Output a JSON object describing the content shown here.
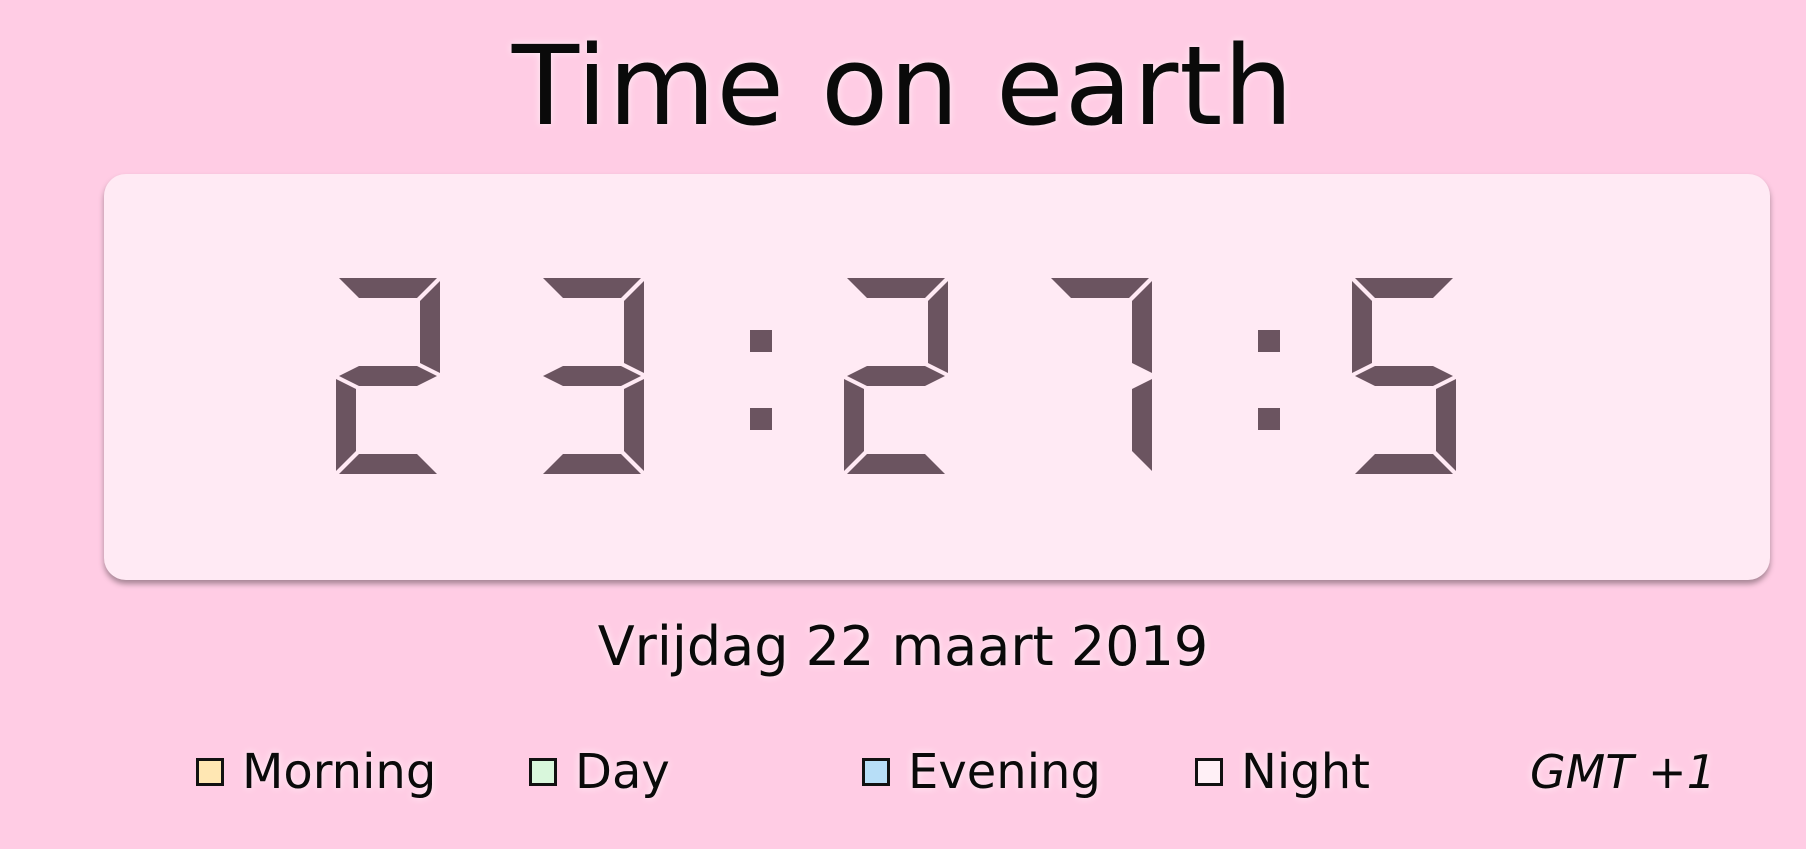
{
  "header": {
    "title": "Time on earth"
  },
  "clock": {
    "time": "23:27:5",
    "segment_color": "#6b5460"
  },
  "date": {
    "text": "Vrijdag 22 maart 2019"
  },
  "legend": {
    "items": [
      {
        "label": "Morning",
        "color": "#ffe7b3"
      },
      {
        "label": "Day",
        "color": "#d9f7dc"
      },
      {
        "label": "Evening",
        "color": "#b7def7"
      },
      {
        "label": "Night",
        "color": "#fff0f6"
      }
    ],
    "timezone": "GMT +1"
  }
}
